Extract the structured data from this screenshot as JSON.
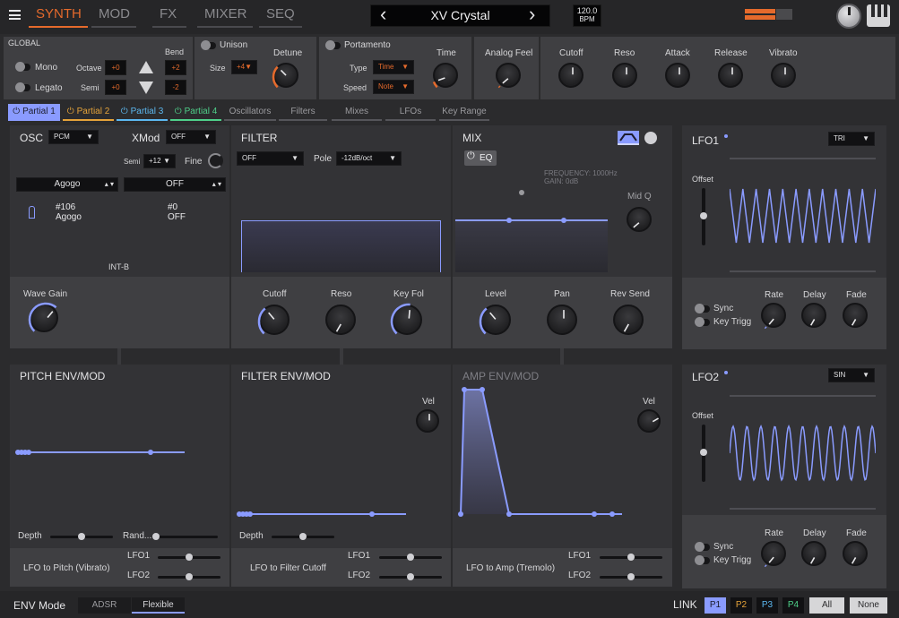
{
  "nav": {
    "tabs": [
      "SYNTH",
      "MOD",
      "FX",
      "MIXER",
      "SEQ"
    ],
    "patch": "XV Crystal",
    "bpm_value": "120.0",
    "bpm_unit": "BPM",
    "prev": "‹",
    "next": "›"
  },
  "global": {
    "label": "GLOBAL",
    "mono": "Mono",
    "legato": "Legato",
    "octave": "Octave",
    "octave_val": "+0",
    "semi": "Semi",
    "semi_val": "+0",
    "bend": "Bend",
    "bend_up": "+2",
    "bend_down": "-2",
    "unison": "Unison",
    "size": "Size",
    "size_val": "+4",
    "detune": "Detune",
    "portamento": "Portamento",
    "type": "Type",
    "type_val": "Time",
    "speed": "Speed",
    "speed_val": "Note",
    "time": "Time",
    "analog_feel": "Analog Feel",
    "cutoff": "Cutoff",
    "reso": "Reso",
    "attack": "Attack",
    "release": "Release",
    "vibrato": "Vibrato"
  },
  "parts": {
    "tabs": [
      "Partial 1",
      "Partial 2",
      "Partial 3",
      "Partial 4"
    ],
    "tab_colors": [
      "#8a9bff",
      "#e5a33a",
      "#5cb8f0",
      "#4fd08a"
    ],
    "sections": [
      "Oscillators",
      "Filters",
      "Mixes",
      "LFOs",
      "Key Range"
    ]
  },
  "osc": {
    "label": "OSC",
    "type": "PCM",
    "xmod": "XMod",
    "xmod_val": "OFF",
    "semi": "Semi",
    "semi_val": "+12",
    "fine": "Fine",
    "wave1": "Agogo",
    "wave2": "OFF",
    "w1_num": "#106",
    "w1_name": "Agogo",
    "w2_num": "#0",
    "w2_name": "OFF",
    "bank": "INT-B",
    "wave_gain": "Wave Gain"
  },
  "filter": {
    "label": "FILTER",
    "type": "OFF",
    "pole": "Pole",
    "pole_val": "-12dB/oct",
    "cutoff": "Cutoff",
    "reso": "Reso",
    "keyfol": "Key Fol"
  },
  "mix": {
    "label": "MIX",
    "eq": "EQ",
    "freq": "FREQUENCY: 1000Hz",
    "gain": "GAIN: 0dB",
    "midq": "Mid Q",
    "level": "Level",
    "pan": "Pan",
    "revsend": "Rev Send"
  },
  "lfo1": {
    "label": "LFO1",
    "wave": "TRI",
    "offset": "Offset",
    "sync": "Sync",
    "keytrig": "Key Trigg",
    "rate": "Rate",
    "delay": "Delay",
    "fade": "Fade"
  },
  "lfo2": {
    "label": "LFO2",
    "wave": "SIN",
    "offset": "Offset",
    "sync": "Sync",
    "keytrig": "Key Trigg",
    "rate": "Rate",
    "delay": "Delay",
    "fade": "Fade"
  },
  "pitchenv": {
    "label": "PITCH ENV/MOD",
    "depth": "Depth",
    "rand": "Rand...",
    "lfo_to": "LFO to Pitch (Vibrato)",
    "lfo1": "LFO1",
    "lfo2": "LFO2"
  },
  "filterenv": {
    "label": "FILTER ENV/MOD",
    "vel": "Vel",
    "depth": "Depth",
    "lfo_to": "LFO to Filter Cutoff",
    "lfo1": "LFO1",
    "lfo2": "LFO2"
  },
  "ampenv": {
    "label": "AMP ENV/MOD",
    "vel": "Vel",
    "lfo_to": "LFO to Amp (Tremolo)",
    "lfo1": "LFO1",
    "lfo2": "LFO2"
  },
  "footer": {
    "env_mode": "ENV Mode",
    "adsr": "ADSR",
    "flexible": "Flexible",
    "link": "LINK",
    "p": [
      "P1",
      "P2",
      "P3",
      "P4"
    ],
    "p_colors": [
      "#8a9bff",
      "#e5a33a",
      "#5cb8f0",
      "#4fd08a"
    ],
    "all": "All",
    "none": "None"
  },
  "colors": {
    "accent": "#e56a2c",
    "blue": "#8a9bff"
  }
}
